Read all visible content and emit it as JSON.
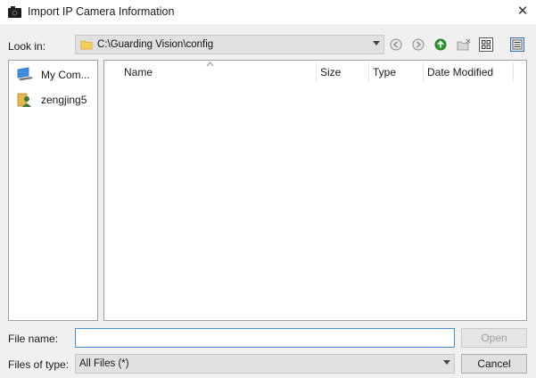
{
  "window": {
    "title": "Import IP Camera Information",
    "close_glyph": "✕"
  },
  "look_in": {
    "label": "Look in:",
    "path": "C:\\Guarding Vision\\config"
  },
  "toolbar": {
    "icons": [
      "back-icon",
      "forward-icon",
      "up-folder-icon",
      "new-folder-icon",
      "list-view-icon",
      "details-view-icon"
    ]
  },
  "places": {
    "items": [
      {
        "label": "My Com...",
        "icon": "computer-icon"
      },
      {
        "label": "zengjing5",
        "icon": "user-icon"
      }
    ]
  },
  "file_list": {
    "columns": [
      "Name",
      "Size",
      "Type",
      "Date Modified"
    ],
    "rows": []
  },
  "file_name": {
    "label": "File name:",
    "value": "",
    "open_label": "Open"
  },
  "file_type": {
    "label": "Files of type:",
    "value": "All Files (*)",
    "cancel_label": "Cancel"
  },
  "colors": {
    "focus_border": "#4a8fd6",
    "dialog_bg": "#f0f0f0",
    "up_arrow_green": "#2e9a2e"
  }
}
